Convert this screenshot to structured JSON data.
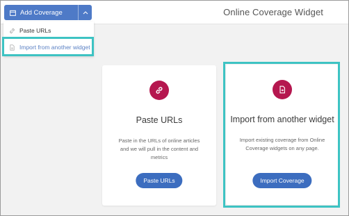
{
  "header": {
    "title": "Online Coverage Widget",
    "add_button_label": "Add Coverage"
  },
  "menu": {
    "items": [
      {
        "label": "Paste URLs",
        "icon": "link-icon"
      },
      {
        "label": "Import from another widget",
        "icon": "file-import-icon"
      }
    ]
  },
  "cards": [
    {
      "icon": "link-icon",
      "title": "Paste URLs",
      "description": "Paste in the URLs of online articles and we will pull in the content and metrics",
      "button_label": "Paste URLs"
    },
    {
      "icon": "file-import-icon",
      "title": "Import from another widget",
      "description": "Import existing coverage from Online Coverage widgets on any page.",
      "button_label": "Import Coverage"
    }
  ],
  "colors": {
    "primary_blue": "#4e7ac7",
    "button_blue": "#3c6dbf",
    "icon_circle": "#b5174f",
    "highlight": "#3dc3c3",
    "menu_active_text": "#5b81c4"
  }
}
